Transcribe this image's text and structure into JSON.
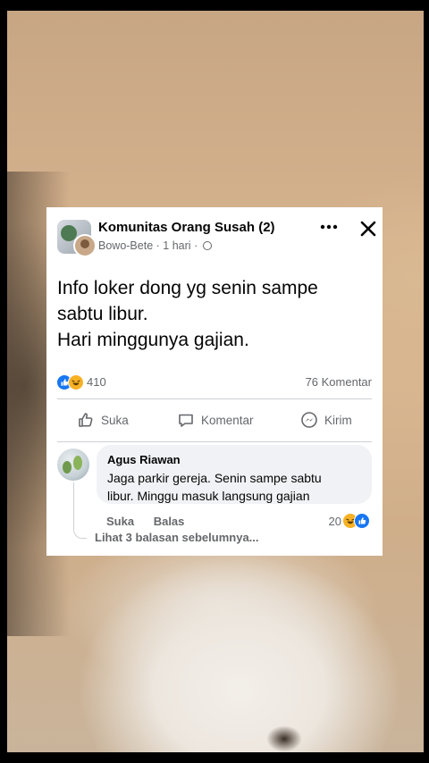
{
  "post": {
    "group_name": "Komunitas Orang Susah (2)",
    "author": "Bowo-Bete",
    "time": "1 hari",
    "separator": "·",
    "more_icon": "more-horizontal-icon",
    "close_icon": "close-icon",
    "text_lines": [
      "Info loker dong yg senin sampe",
      "sabtu libur.",
      "Hari minggunya gajian."
    ],
    "reaction_count": "410",
    "comment_count": "76 Komentar"
  },
  "actions": {
    "like": "Suka",
    "comment": "Komentar",
    "share": "Kirim"
  },
  "comment": {
    "name": "Agus Riawan",
    "text_lines": [
      "Jaga parkir gereja. Senin sampe sabtu",
      "libur. Minggu masuk langsung gajian"
    ],
    "like": "Suka",
    "reply": "Balas",
    "reaction_count": "20",
    "more_replies": "Lihat 3 balasan sebelumnya..."
  },
  "colors": {
    "accent": "#1877f2",
    "haha": "#f7b125",
    "secondary_text": "#65676b"
  }
}
